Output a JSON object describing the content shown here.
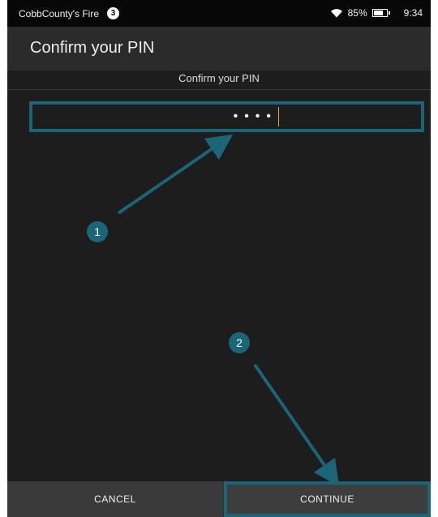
{
  "status_bar": {
    "carrier": "CobbCounty's Fire",
    "notification_count": "3",
    "battery": "85%",
    "battery_level": 0.85,
    "time": "9:34"
  },
  "header": {
    "title": "Confirm your PIN"
  },
  "pin_field": {
    "label": "Confirm your PIN",
    "masked_value": "••••"
  },
  "callouts": [
    "1",
    "2"
  ],
  "buttons": {
    "cancel": "CANCEL",
    "continue": "CONTINUE"
  },
  "colors": {
    "highlight": "#1a6578",
    "caret": "#e8a33a"
  }
}
